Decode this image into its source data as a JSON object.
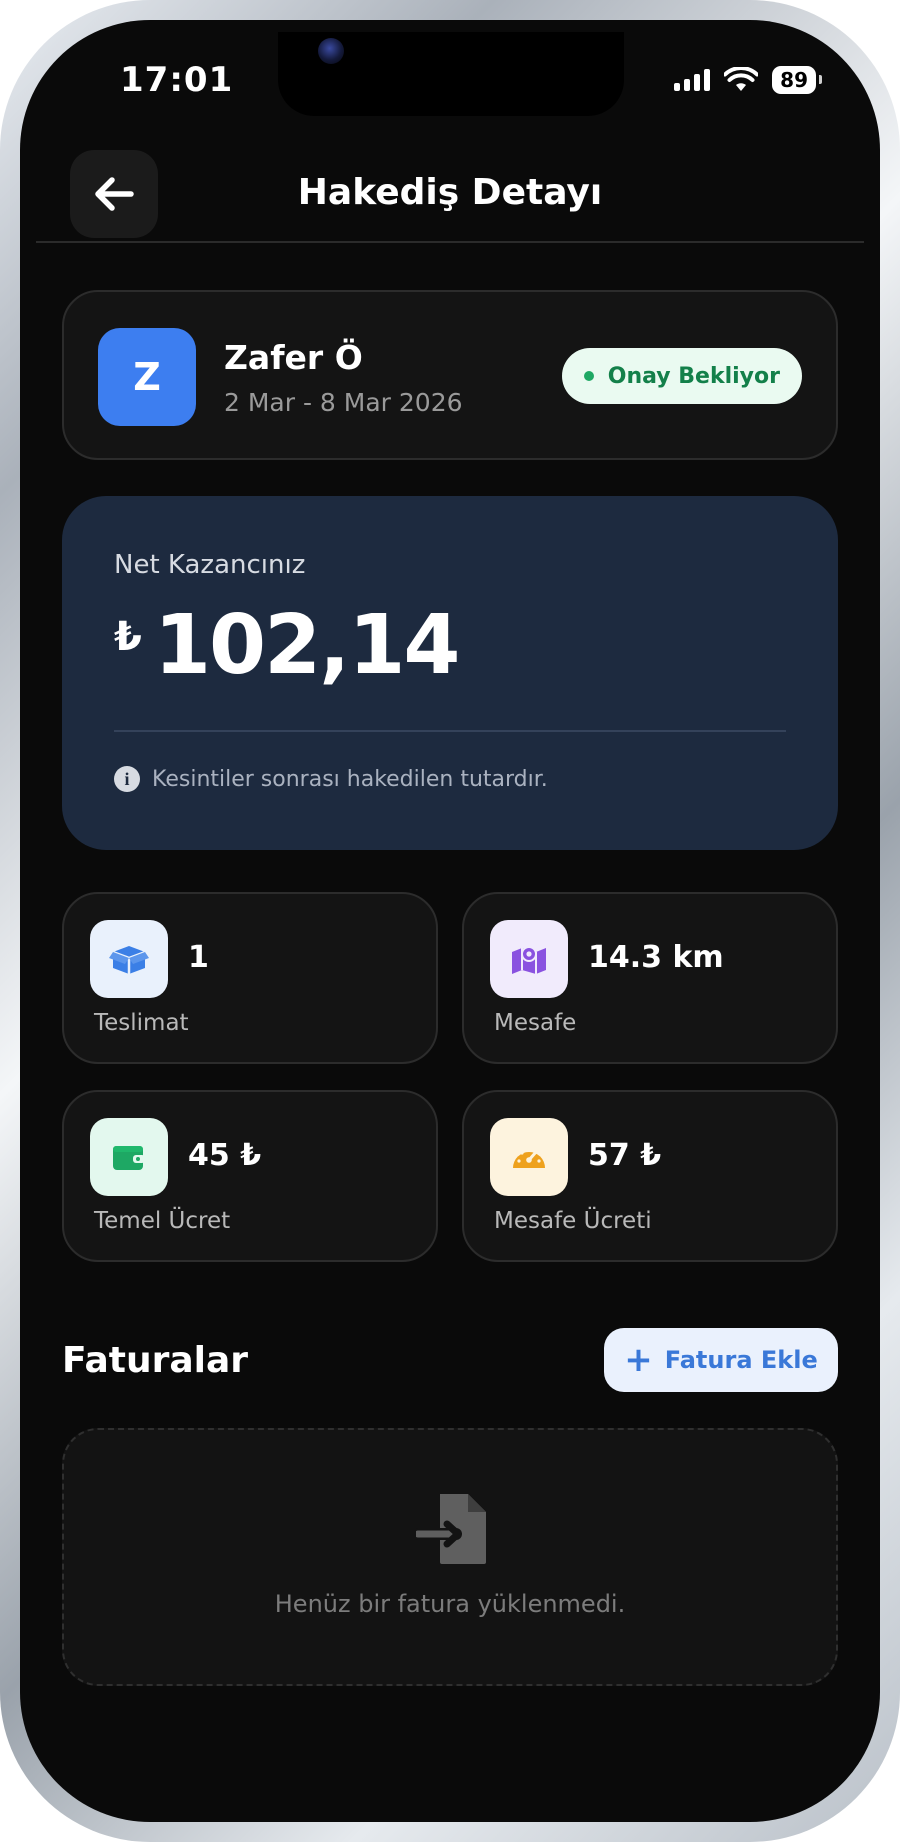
{
  "status_bar": {
    "time": "17:01",
    "battery": "89"
  },
  "header": {
    "title": "Hakediş Detayı"
  },
  "profile": {
    "initial": "Z",
    "name": "Zafer Ö",
    "date_range": "2 Mar - 8 Mar 2026",
    "status": "Onay Bekliyor"
  },
  "earnings": {
    "label": "Net Kazancınız",
    "currency": "₺",
    "amount": "102,14",
    "note": "Kesintiler sonrası hakedilen tutardır."
  },
  "stats": [
    {
      "value": "1",
      "label": "Teslimat",
      "icon": "box-icon"
    },
    {
      "value": "14.3 km",
      "label": "Mesafe",
      "icon": "map-icon"
    },
    {
      "value": "45 ₺",
      "label": "Temel Ücret",
      "icon": "wallet-icon"
    },
    {
      "value": "57 ₺",
      "label": "Mesafe Ücreti",
      "icon": "speedometer-icon"
    }
  ],
  "invoices": {
    "title": "Faturalar",
    "add_button": "Fatura Ekle",
    "empty_message": "Henüz bir fatura yüklenmedi."
  },
  "colors": {
    "background": "#0a0a0a",
    "accent_blue": "#3d7ef0",
    "earnings_card": "#1d2a3f",
    "status_green": "#1fa864"
  }
}
